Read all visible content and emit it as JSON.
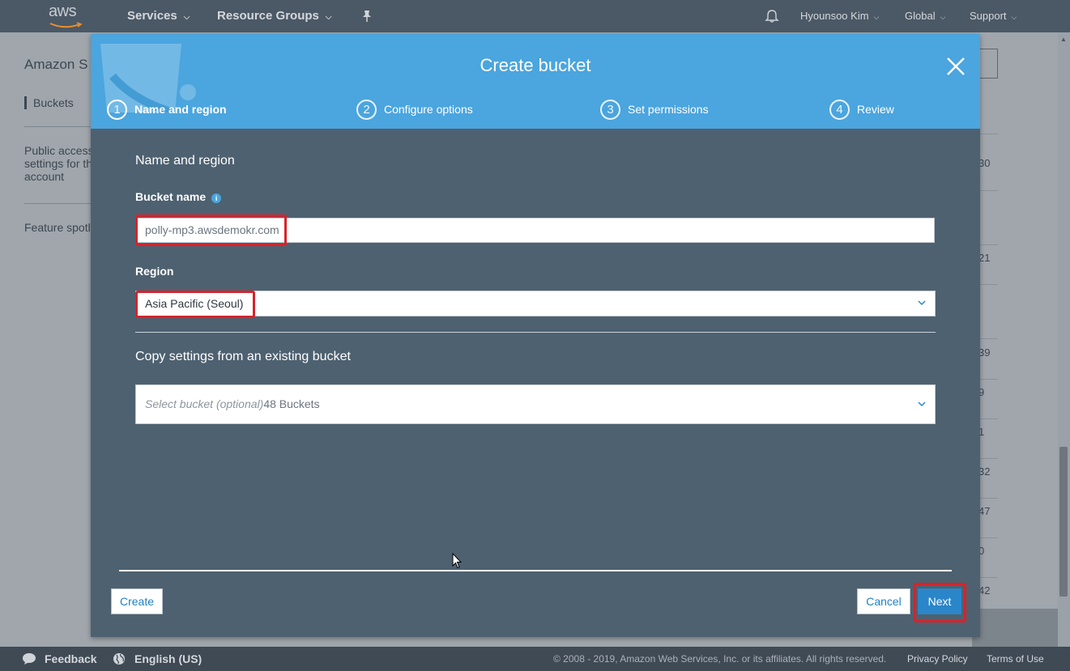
{
  "topnav": {
    "logo_text": "aws",
    "services": "Services",
    "resource_groups": "Resource Groups",
    "user": "Hyounsoo Kim",
    "region": "Global",
    "support": "Support"
  },
  "background": {
    "title": "Amazon S",
    "sidebar": {
      "buckets": "Buckets",
      "public_access_1": "Public access",
      "public_access_2": "settings for th",
      "public_access_3": "account",
      "feature": "Feature spotl"
    },
    "numbers": [
      "30",
      "21",
      "39",
      "9",
      "1",
      "32",
      "47",
      "0",
      "42"
    ]
  },
  "modal": {
    "title": "Create bucket",
    "steps": [
      {
        "num": "1",
        "label": "Name and region"
      },
      {
        "num": "2",
        "label": "Configure options"
      },
      {
        "num": "3",
        "label": "Set permissions"
      },
      {
        "num": "4",
        "label": "Review"
      }
    ],
    "section_title": "Name and region",
    "bucket_name_label": "Bucket name",
    "bucket_name_value": "polly-mp3.awsdemokr.com",
    "region_label": "Region",
    "region_value": "Asia Pacific (Seoul)",
    "copy_title": "Copy settings from an existing bucket",
    "copy_placeholder": "Select bucket (optional)",
    "copy_count": "48 Buckets",
    "create_button": "Create",
    "cancel_button": "Cancel",
    "next_button": "Next"
  },
  "footer": {
    "feedback": "Feedback",
    "language": "English (US)",
    "copyright": "© 2008 - 2019, Amazon Web Services, Inc. or its affiliates. All rights reserved.",
    "privacy": "Privacy Policy",
    "terms": "Terms of Use"
  },
  "colors": {
    "nav_bg": "#4b5866",
    "modal_header": "#4ba5de",
    "modal_body": "#4e6170",
    "highlight": "#d9222a",
    "primary": "#2a86c9"
  }
}
